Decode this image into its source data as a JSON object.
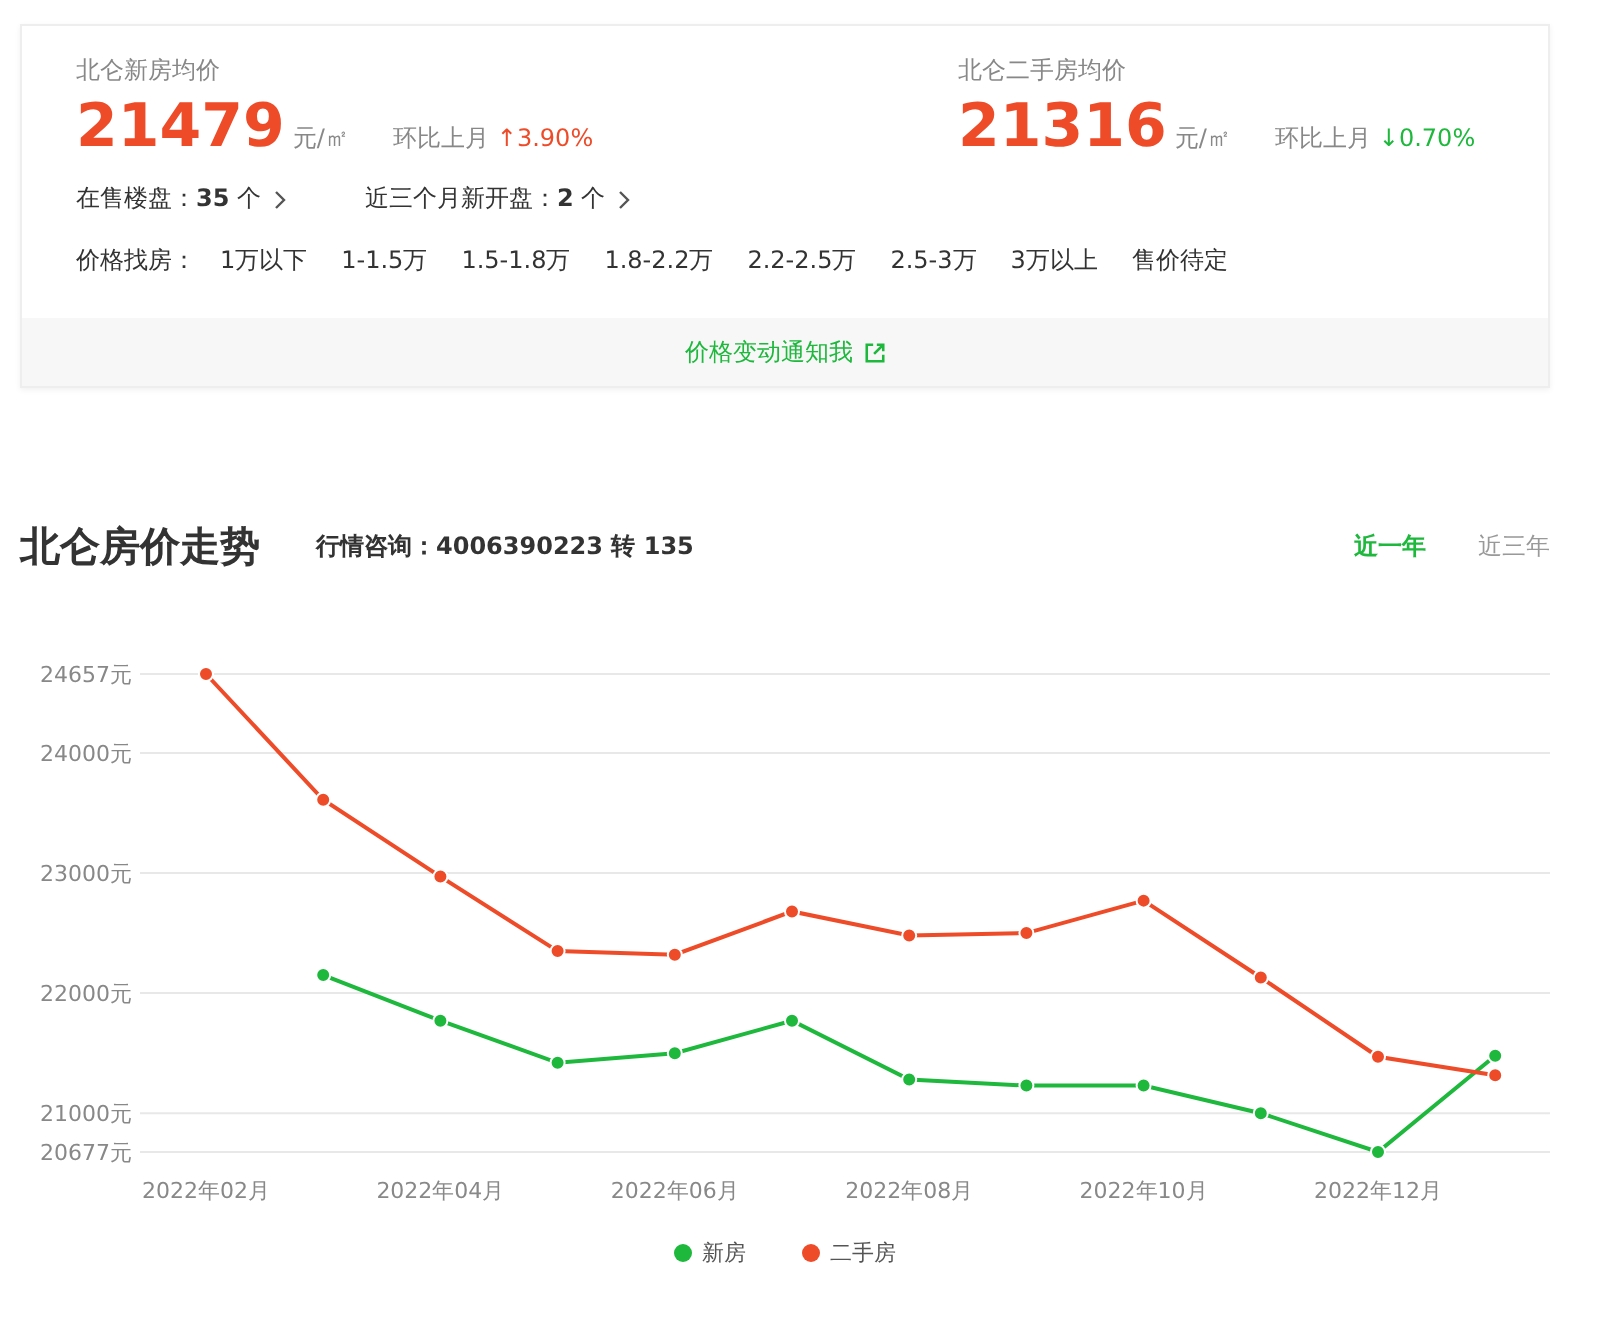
{
  "summary": {
    "new_house": {
      "title": "北仑新房均价",
      "price": "21479",
      "unit": "元/㎡",
      "change_label": "环比上月",
      "change": {
        "text": "↑3.90%",
        "color": "#ee4b28"
      }
    },
    "second_hand": {
      "title": "北仑二手房均价",
      "price": "21316",
      "unit": "元/㎡",
      "change_label": "环比上月",
      "change": {
        "text": "↓0.70%",
        "color": "#1db83c"
      }
    },
    "stats": [
      {
        "label": "在售楼盘：",
        "value": "35",
        "unit": "个"
      },
      {
        "label": "近三个月新开盘：",
        "value": "2",
        "unit": "个"
      }
    ],
    "price_filter": {
      "label": "价格找房：",
      "options": [
        "1万以下",
        "1-1.5万",
        "1.5-1.8万",
        "1.8-2.2万",
        "2.2-2.5万",
        "2.5-3万",
        "3万以上",
        "售价待定"
      ]
    },
    "notify_link": "价格变动通知我"
  },
  "trend": {
    "title": "北仑房价走势",
    "hotline_label": "行情咨询：",
    "hotline": "4006390223 转 135",
    "tabs": [
      {
        "label": "近一年",
        "selected": true
      },
      {
        "label": "近三年",
        "selected": false
      }
    ],
    "chart_data": {
      "type": "line",
      "categories": [
        "2022年02月",
        null,
        "2022年04月",
        null,
        "2022年06月",
        null,
        "2022年08月",
        null,
        "2022年10月",
        null,
        "2022年12月",
        null
      ],
      "ylim": [
        20677,
        24657
      ],
      "grid": true,
      "yticks": [
        {
          "value": 24657,
          "label": "24657元"
        },
        {
          "value": 24000,
          "label": "24000元"
        },
        {
          "value": 23000,
          "label": "23000元"
        },
        {
          "value": 22000,
          "label": "22000元"
        },
        {
          "value": 21000,
          "label": "21000元"
        },
        {
          "value": 20677,
          "label": "20677元"
        }
      ],
      "series": [
        {
          "name": "新房",
          "color": "#1db83c",
          "marker": "circle",
          "values": [
            null,
            22150,
            21770,
            21420,
            21500,
            21770,
            21280,
            21230,
            21230,
            21000,
            20677,
            21479
          ]
        },
        {
          "name": "二手房",
          "color": "#ee4b28",
          "marker": "circle",
          "values": [
            24657,
            23610,
            22970,
            22350,
            22320,
            22680,
            22480,
            22500,
            22770,
            22130,
            21470,
            21316
          ]
        }
      ]
    }
  }
}
